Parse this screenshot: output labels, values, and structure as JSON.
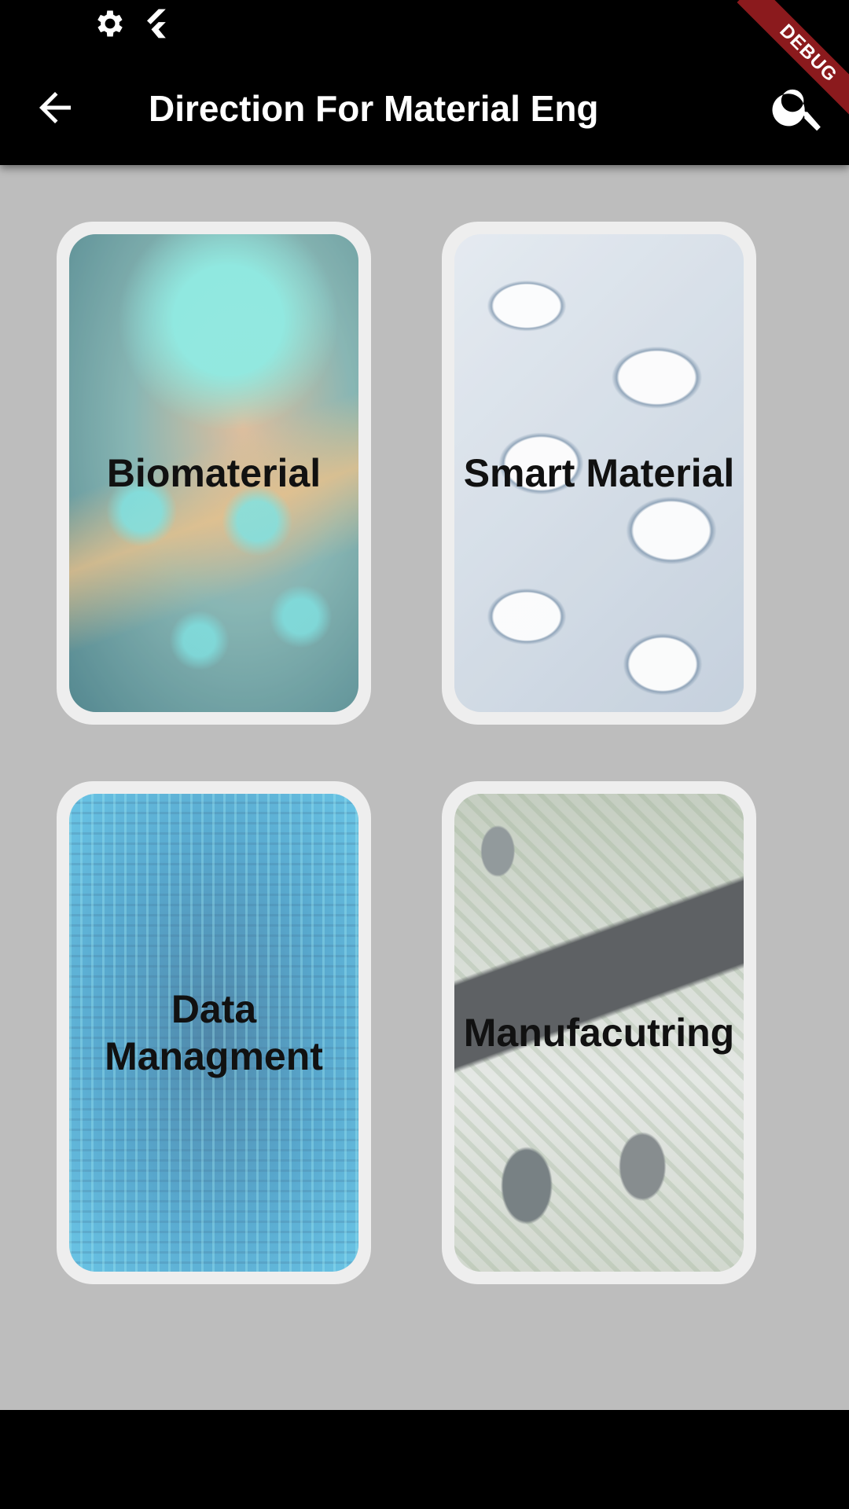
{
  "app_bar": {
    "title": "Direction For Material Eng"
  },
  "debug_banner": "DEBUG",
  "icons": {
    "status": [
      "gear-icon",
      "flutter-icon"
    ],
    "back": "arrow-left-icon",
    "search": "search-icon"
  },
  "cards": [
    {
      "label": "Biomaterial",
      "image": "biomaterial-image"
    },
    {
      "label": "Smart Material",
      "image": "smart-material-image"
    },
    {
      "label": "Data Managment",
      "image": "data-management-image"
    },
    {
      "label": "Manufacutring",
      "image": "manufacturing-image"
    }
  ],
  "colors": {
    "app_bar": "#000000",
    "background": "#bdbdbd",
    "card_border": "#eeeeee",
    "debug_ribbon": "#8b1a1d"
  }
}
